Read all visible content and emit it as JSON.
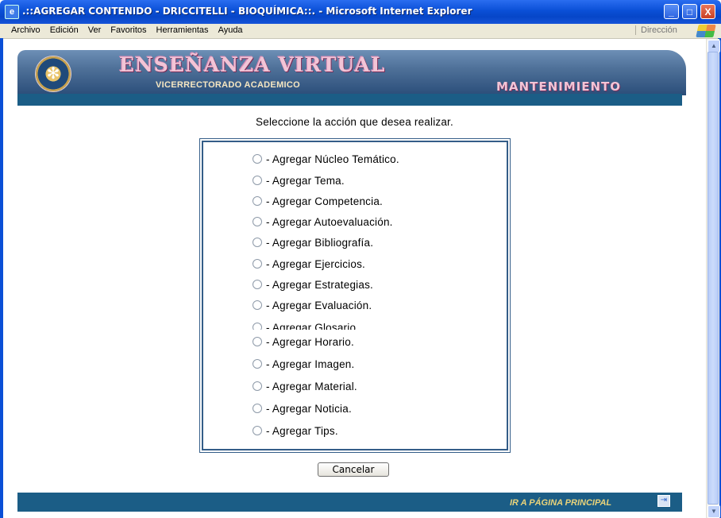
{
  "window": {
    "title": ".::AGREGAR CONTENIDO - DRICCITELLI - BIOQUÍMICA::. - Microsoft Internet Explorer",
    "minimize": "_",
    "maximize": "□",
    "close": "X"
  },
  "menu": {
    "items": [
      "Archivo",
      "Edición",
      "Ver",
      "Favoritos",
      "Herramientas",
      "Ayuda"
    ],
    "address_label": "Dirección"
  },
  "banner": {
    "name": "ENSEÑANZA VIRTUAL",
    "subtitle": "VICERRECTORADO ACADEMICO",
    "section": "MANTENIMIENTO"
  },
  "form": {
    "prompt": "Seleccione la acción que desea realizar.",
    "options": [
      "- Agregar Núcleo Temático.",
      "- Agregar Tema.",
      "- Agregar Competencia.",
      "- Agregar Autoevaluación.",
      "- Agregar Bibliografía.",
      "- Agregar Ejercicios.",
      "- Agregar Estrategias.",
      "- Agregar Evaluación.",
      "- Agregar Glosario",
      "- Agregar Horario.",
      "- Agregar Imagen.",
      "- Agregar Material.",
      "- Agregar Noticia.",
      "- Agregar Tips."
    ],
    "cancel_label": "Cancelar"
  },
  "footer": {
    "home_link": "IR A PÁGINA PRINCIPAL"
  },
  "scrollbar": {
    "up": "▲",
    "down": "▼"
  }
}
